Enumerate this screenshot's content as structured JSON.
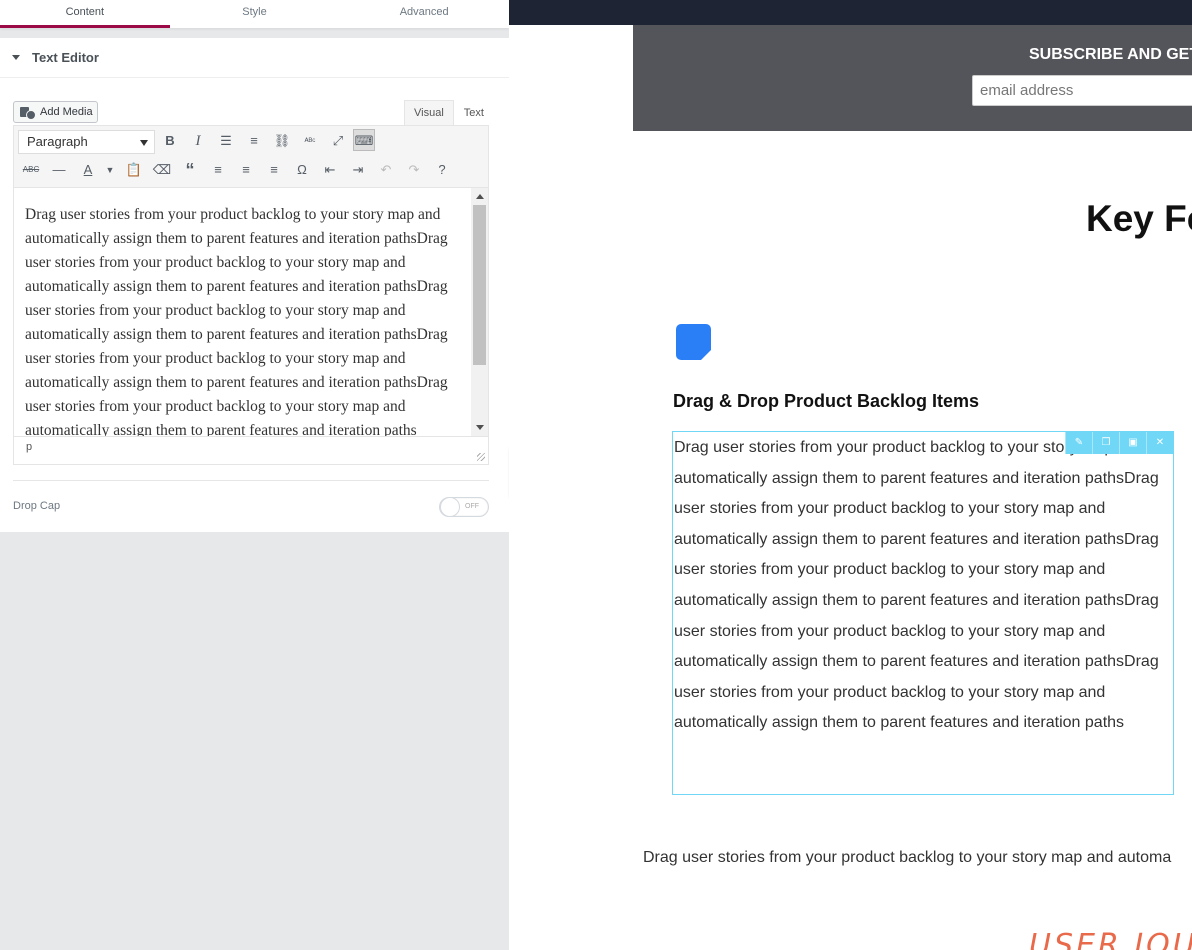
{
  "panel": {
    "tabs": [
      {
        "label": "Content"
      },
      {
        "label": "Style"
      },
      {
        "label": "Advanced"
      }
    ],
    "section_title": "Text Editor",
    "add_media_label": "Add Media",
    "editor_tabs": [
      {
        "label": "Visual"
      },
      {
        "label": "Text"
      }
    ],
    "format_select": "Paragraph",
    "editor_content": "Drag user stories from your product backlog to your story map and automatically assign them to parent features and iteration pathsDrag user stories from your product backlog to your story map and automatically assign them to parent features and iteration pathsDrag user stories from your product backlog to your story map and automatically assign them to parent features and iteration pathsDrag user stories from your product backlog to your story map and automatically assign them to parent features and iteration pathsDrag user stories from your product backlog to your story map and automatically assign them to parent features and iteration paths",
    "status_path": "p",
    "drop_cap_label": "Drop Cap",
    "drop_cap_state": "OFF"
  },
  "preview": {
    "subscribe_title": "SUBSCRIBE AND GET",
    "email_placeholder": "email address",
    "key_features_title": "Key Fe",
    "feature_heading": "Drag & Drop Product Backlog Items",
    "feature_text": "Drag user stories from your product backlog to your story map and automatically assign them to parent features and iteration pathsDrag user stories from your product backlog to your story map and automatically assign them to parent features and iteration pathsDrag user stories from your product backlog to your story map and automatically assign them to parent features and iteration pathsDrag user stories from your product backlog to your story map and automatically assign them to parent features and iteration pathsDrag user stories from your product backlog to your story map and automatically assign them to parent features and iteration paths",
    "bottom_text": "Drag user stories from your product backlog to your story map and automa",
    "script_text": "USER JOU"
  },
  "colors": {
    "accent": "#9b0a46",
    "selection_border": "#71d7f7",
    "feature_icon": "#2b7ff6",
    "subscribe_bg": "#54555a"
  }
}
